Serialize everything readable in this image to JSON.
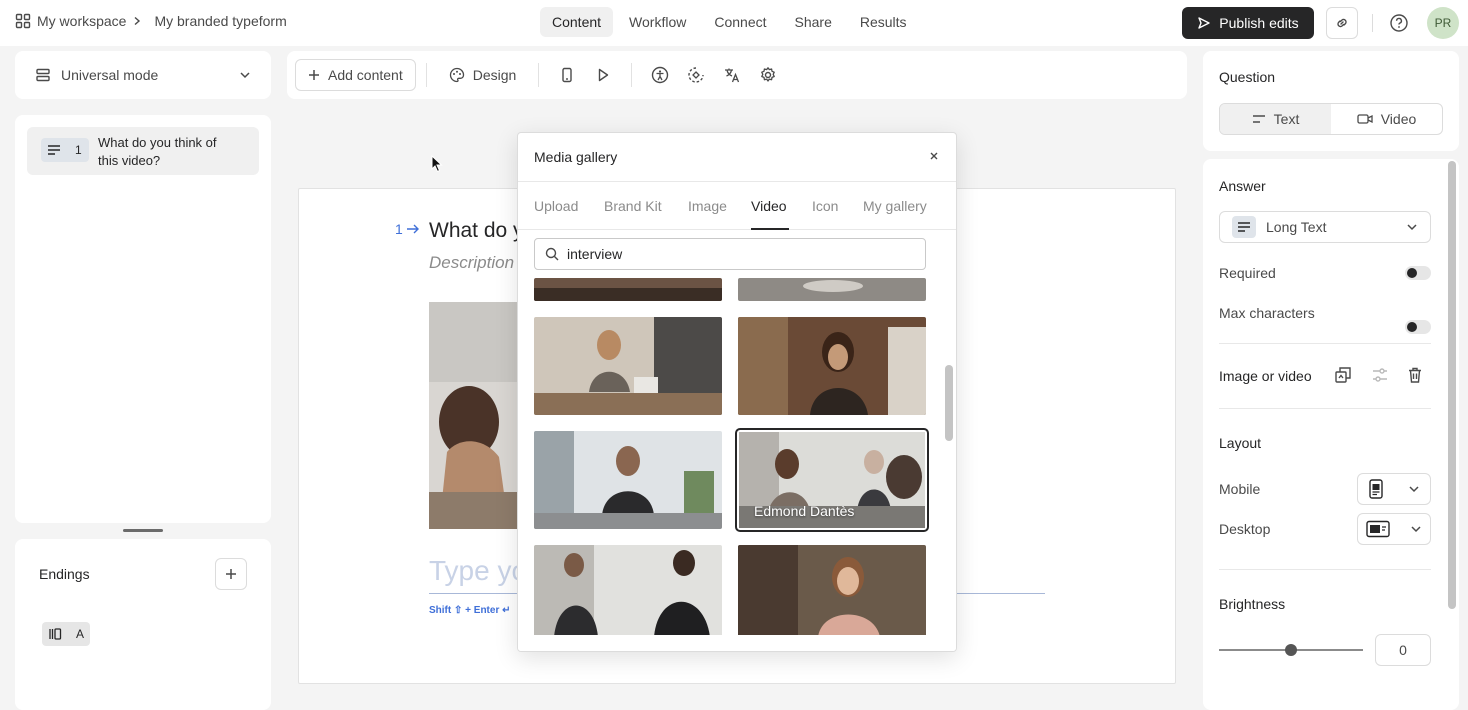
{
  "breadcrumb": {
    "workspace": "My workspace",
    "form": "My branded typeform"
  },
  "nav": {
    "tabs": [
      "Content",
      "Workflow",
      "Connect",
      "Share",
      "Results"
    ],
    "active": "Content"
  },
  "header": {
    "publish_label": "Publish edits",
    "avatar_initials": "PR"
  },
  "left": {
    "mode_label": "Universal mode",
    "question": {
      "number": "1",
      "text_line1": "What do you think of",
      "text_line2": "this video?"
    },
    "endings_label": "Endings",
    "ending_badge": "A"
  },
  "toolbar": {
    "add_content": "Add content",
    "design": "Design"
  },
  "canvas": {
    "q_number": "1",
    "q_title_partial": "What do y",
    "description_partial": "Description",
    "answer_placeholder_partial": "Type you",
    "hint": "Shift ⇧ + Enter ↵"
  },
  "modal": {
    "title": "Media gallery",
    "tabs": [
      "Upload",
      "Brand Kit",
      "Image",
      "Video",
      "Icon",
      "My gallery"
    ],
    "active_tab": "Video",
    "search_value": "interview",
    "hovered_label": "Edmond Dantès"
  },
  "right": {
    "question_label": "Question",
    "question_types": [
      "Text",
      "Video"
    ],
    "answer_label": "Answer",
    "answer_type": "Long Text",
    "required_label": "Required",
    "max_chars_label": "Max characters",
    "image_video_label": "Image or video",
    "layout_label": "Layout",
    "mobile_label": "Mobile",
    "desktop_label": "Desktop",
    "brightness_label": "Brightness",
    "brightness_value": "0"
  },
  "colors": {
    "dark": "#262627",
    "panel": "#ffffff",
    "bg": "#f4f4f4",
    "avatar": "#cfe3c8"
  }
}
